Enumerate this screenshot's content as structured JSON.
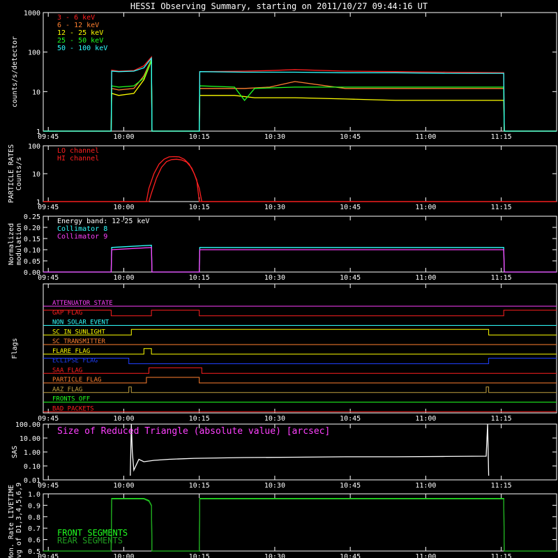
{
  "title": "HESSI Observing Summary, starting on 2011/10/27 09:44:16 UT",
  "colors": {
    "red": "#ff2020",
    "orange": "#ff8030",
    "yellow": "#ffff00",
    "green": "#20ff20",
    "cyan": "#30ffff",
    "magenta": "#ff40ff",
    "blue": "#2040ff",
    "darkgreen": "#20c020",
    "white": "#ffffff",
    "olive": "#c0a040"
  },
  "time_axis": {
    "start_min": 0,
    "end_min": 102,
    "tick_labels": [
      "09:45",
      "10:00",
      "10:15",
      "10:30",
      "10:45",
      "11:00",
      "11:15"
    ],
    "tick_minutes": [
      1,
      16,
      31,
      46,
      61,
      76,
      91
    ]
  },
  "chart_data": [
    {
      "id": "counts",
      "type": "line",
      "ylabel": "counts/s/detector",
      "yscale": "log",
      "ylim": [
        1,
        1000
      ],
      "ytick_labels": [
        "1",
        "10",
        "100",
        "1000"
      ],
      "ytick_values": [
        1,
        10,
        100,
        1000
      ],
      "legend_placement": "top-left",
      "series": [
        {
          "name": "3 - 6 keV",
          "color": "#ff2020",
          "x": [
            0,
            13.5,
            13.6,
            15,
            18,
            20,
            21.5,
            21.6,
            31,
            31.1,
            40,
            45,
            50,
            60,
            70,
            80,
            91.5,
            91.6,
            102
          ],
          "y": [
            1,
            1,
            35,
            33,
            34,
            45,
            75,
            1,
            1,
            32,
            33,
            34,
            36,
            33,
            32,
            31,
            30,
            1,
            1
          ]
        },
        {
          "name": "6 - 12 keV",
          "color": "#ff8030",
          "x": [
            0,
            13.5,
            13.6,
            15,
            18,
            20,
            21.5,
            21.6,
            31,
            31.1,
            40,
            45,
            50,
            60,
            70,
            80,
            91.5,
            91.6,
            102
          ],
          "y": [
            1,
            1,
            12,
            11,
            12,
            25,
            65,
            1,
            1,
            12,
            12,
            13,
            18,
            12,
            12,
            12,
            12,
            1,
            1
          ]
        },
        {
          "name": "12 - 25 keV",
          "color": "#ffff00",
          "x": [
            0,
            13.5,
            13.6,
            15,
            18,
            20,
            21.5,
            21.6,
            31,
            31.1,
            38,
            42,
            50,
            60,
            70,
            80,
            91.5,
            91.6,
            102
          ],
          "y": [
            1,
            1,
            9,
            8,
            9,
            20,
            60,
            1,
            1,
            8,
            8,
            7,
            7,
            6.5,
            6,
            6,
            6,
            1,
            1
          ]
        },
        {
          "name": "25 - 50 keV",
          "color": "#20ff20",
          "x": [
            0,
            13.5,
            13.6,
            15,
            18,
            20,
            21.5,
            21.6,
            31,
            31.1,
            38,
            40,
            42,
            50,
            60,
            70,
            80,
            91.5,
            91.6,
            102
          ],
          "y": [
            1,
            1,
            14,
            13,
            14,
            22,
            62,
            1,
            1,
            14,
            13,
            6,
            12,
            13,
            13,
            13,
            13,
            13,
            1,
            1
          ]
        },
        {
          "name": "50 - 100 keV",
          "color": "#30ffff",
          "x": [
            0,
            13.5,
            13.6,
            15,
            18,
            20,
            21.5,
            21.6,
            31,
            31.1,
            40,
            50,
            60,
            70,
            80,
            91.5,
            91.6,
            102
          ],
          "y": [
            1,
            1,
            33,
            32,
            33,
            40,
            70,
            1,
            1,
            32,
            31,
            31,
            30,
            30,
            29,
            29,
            1,
            1
          ]
        }
      ]
    },
    {
      "id": "particle",
      "type": "line",
      "ylabel": "PARTICLE RATES\nCounts/s",
      "yscale": "log",
      "ylim": [
        1,
        100
      ],
      "ytick_labels": [
        "1",
        "10",
        "100"
      ],
      "ytick_values": [
        1,
        10,
        100
      ],
      "legend_placement": "top-left",
      "series": [
        {
          "name": "LO channel",
          "color": "#ff2020",
          "x": [
            0,
            20.5,
            21,
            22,
            23,
            24,
            25,
            26,
            27,
            28,
            29,
            30,
            31,
            31.5,
            102
          ],
          "y": [
            1,
            1,
            3,
            10,
            22,
            33,
            40,
            41,
            40,
            33,
            22,
            10,
            3,
            1,
            1
          ]
        },
        {
          "name": "HI channel",
          "color": "#ff2020",
          "x": [
            0,
            21,
            21.5,
            22.5,
            23.5,
            24.5,
            25.5,
            26.5,
            27.5,
            28.5,
            29.5,
            30.5,
            31,
            102
          ],
          "y": [
            1,
            1,
            2,
            7,
            17,
            27,
            32,
            33,
            31,
            26,
            16,
            6,
            1,
            1
          ]
        }
      ]
    },
    {
      "id": "modulation",
      "type": "line",
      "ylabel": "Normalized\nmodulation",
      "yscale": "linear",
      "ylim": [
        0,
        0.25
      ],
      "ytick_labels": [
        "0.00",
        "0.05",
        "0.10",
        "0.15",
        "0.20",
        "0.25"
      ],
      "ytick_values": [
        0,
        0.05,
        0.1,
        0.15,
        0.2,
        0.25
      ],
      "annotation": "Energy band: 12-25 keV",
      "legend_placement": "top-left",
      "series": [
        {
          "name": "Collimator 8",
          "color": "#30ffff",
          "x": [
            0,
            13.5,
            13.6,
            21.5,
            21.6,
            31,
            31.1,
            91.5,
            91.6,
            102
          ],
          "y": [
            0,
            0,
            0.11,
            0.12,
            0,
            0,
            0.11,
            0.11,
            0,
            0
          ]
        },
        {
          "name": "Collimator 9",
          "color": "#ff40ff",
          "x": [
            0,
            13.5,
            13.6,
            21.5,
            21.6,
            31,
            31.1,
            91.5,
            91.6,
            102
          ],
          "y": [
            0,
            0,
            0.1,
            0.11,
            0,
            0,
            0.1,
            0.1,
            0,
            0
          ]
        }
      ]
    },
    {
      "id": "flags",
      "type": "line",
      "ylabel": "Flags",
      "series": [
        {
          "name": "ATTENUATOR STATE",
          "color": "#ff40ff",
          "x": [
            0,
            102
          ],
          "y": [
            0,
            0
          ]
        },
        {
          "name": "GAP FLAG",
          "color": "#ff2020",
          "x": [
            0,
            13.5,
            13.5,
            21.5,
            21.5,
            31,
            31,
            91.5,
            91.5,
            102
          ],
          "y": [
            1,
            1,
            0,
            0,
            1,
            1,
            0,
            0,
            1,
            1
          ]
        },
        {
          "name": "NON SOLAR EVENT",
          "color": "#30ffff",
          "x": [
            0,
            102
          ],
          "y": [
            0,
            0
          ]
        },
        {
          "name": "SC IN SUNLIGHT",
          "color": "#ffff00",
          "x": [
            0,
            17.5,
            17.5,
            88.5,
            88.5,
            102
          ],
          "y": [
            0,
            0,
            1,
            1,
            0,
            0
          ]
        },
        {
          "name": "SC TRANSMITTER",
          "color": "#ff8030",
          "x": [
            0,
            102
          ],
          "y": [
            0,
            0
          ]
        },
        {
          "name": "FLARE FLAG",
          "color": "#ffff00",
          "x": [
            0,
            20,
            20,
            21.5,
            21.5,
            102
          ],
          "y": [
            0,
            0,
            1,
            1,
            0,
            0
          ]
        },
        {
          "name": "ECLIPSE FLAG",
          "color": "#2040ff",
          "x": [
            0,
            17,
            17,
            88.5,
            88.5,
            102
          ],
          "y": [
            1,
            1,
            0,
            0,
            1,
            1
          ]
        },
        {
          "name": "SAA FLAG",
          "color": "#ff2020",
          "x": [
            0,
            21,
            21,
            31.5,
            31.5,
            102
          ],
          "y": [
            0,
            0,
            1,
            1,
            0,
            0
          ]
        },
        {
          "name": "PARTICLE FLAG",
          "color": "#ff8030",
          "x": [
            0,
            20.5,
            20.5,
            31,
            31,
            102
          ],
          "y": [
            0,
            0,
            1,
            1,
            0,
            0
          ]
        },
        {
          "name": "AAZ FLAG",
          "color": "#c0a040",
          "x": [
            0,
            17,
            17,
            17.5,
            17.5,
            88,
            88,
            88.5,
            88.5,
            102
          ],
          "y": [
            0,
            0,
            1,
            1,
            0,
            0,
            1,
            1,
            0,
            0
          ]
        },
        {
          "name": "FRONTS OFF",
          "color": "#20ff20",
          "x": [
            0,
            102
          ],
          "y": [
            0,
            0
          ]
        },
        {
          "name": "BAD PACKETS",
          "color": "#ff2020",
          "x": [
            0,
            102
          ],
          "y": [
            0,
            0
          ]
        }
      ]
    },
    {
      "id": "sas",
      "type": "line",
      "ylabel": "SAS",
      "yscale": "log",
      "ylim": [
        0.01,
        100
      ],
      "ytick_labels": [
        "0.01",
        "0.10",
        "1.00",
        "10.00",
        "100.00"
      ],
      "ytick_values": [
        0.01,
        0.1,
        1,
        10,
        100
      ],
      "annotation": "Size of Reduced Triangle (absolute value) [arcsec]",
      "series": [
        {
          "name": "",
          "color": "#ffffff",
          "x": [
            17.3,
            17.5,
            17.7,
            18,
            19,
            20,
            22,
            25,
            30,
            40,
            50,
            60,
            70,
            80,
            88,
            88.3,
            88.5
          ],
          "y": [
            0.02,
            100,
            1.0,
            0.05,
            0.3,
            0.2,
            0.25,
            0.3,
            0.35,
            0.4,
            0.42,
            0.45,
            0.45,
            0.48,
            0.5,
            100,
            0.02
          ]
        }
      ]
    },
    {
      "id": "livetime",
      "type": "line",
      "ylabel": "Mon. Rate LIVETIME\navg of D1,3,4,5,6,9",
      "yscale": "linear",
      "ylim": [
        0.5,
        1.0
      ],
      "ytick_labels": [
        "0.5",
        "0.6",
        "0.7",
        "0.8",
        "0.9",
        "1.0"
      ],
      "ytick_values": [
        0.5,
        0.6,
        0.7,
        0.8,
        0.9,
        1.0
      ],
      "legend_placement": "bottom-left",
      "series": [
        {
          "name": "FRONT SEGMENTS",
          "color": "#20ff20",
          "x": [
            0,
            13.5,
            13.6,
            20,
            21,
            21.5,
            21.6,
            31,
            31.1,
            91.5,
            91.6,
            102
          ],
          "y": [
            0.5,
            0.5,
            0.96,
            0.96,
            0.94,
            0.9,
            0.5,
            0.5,
            0.96,
            0.96,
            0.5,
            0.5
          ]
        },
        {
          "name": "REAR SEGMENTS",
          "color": "#20a020",
          "x": [
            0,
            13.5,
            13.6,
            20,
            21,
            21.5,
            21.6,
            31,
            31.1,
            91.5,
            91.6,
            102
          ],
          "y": [
            0.5,
            0.5,
            0.955,
            0.955,
            0.935,
            0.895,
            0.5,
            0.5,
            0.955,
            0.955,
            0.5,
            0.5
          ]
        }
      ]
    }
  ]
}
